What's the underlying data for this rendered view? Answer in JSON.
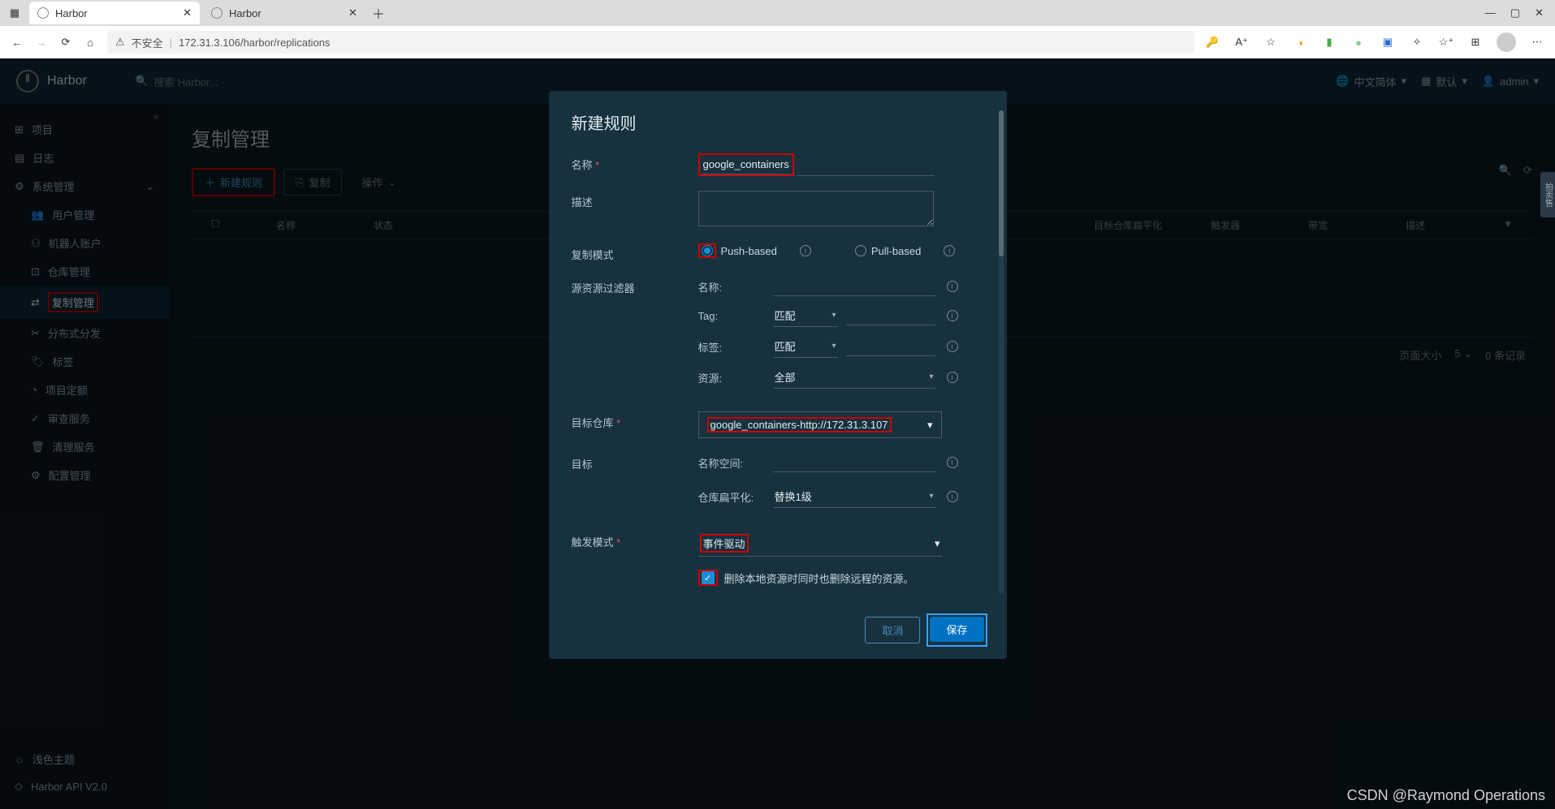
{
  "browser": {
    "tab1": "Harbor",
    "tab2": "Harbor",
    "url_prefix": "不安全",
    "url": "172.31.3.106/harbor/replications",
    "win_min": "—",
    "win_max": "▢",
    "win_close": "✕"
  },
  "header": {
    "brand": "Harbor",
    "search_ph": "搜索 Harbor...",
    "lang": "中文简体",
    "theme": "默认",
    "user": "admin"
  },
  "sidebar": {
    "collapse": "«",
    "items": {
      "projects": "项目",
      "logs": "日志",
      "sysmgmt": "系统管理",
      "usermgmt": "用户管理",
      "robots": "机器人账户",
      "registry": "仓库管理",
      "replication": "复制管理",
      "distribution": "分布式分发",
      "labels": "标签",
      "quotas": "项目定额",
      "interrogation": "审查服务",
      "gc": "清理服务",
      "config": "配置管理",
      "light_theme": "浅色主题",
      "api": "Harbor API V2.0"
    }
  },
  "main": {
    "title": "复制管理",
    "new_rule": "新建规则",
    "copy": "复制",
    "actions": "操作",
    "cols": {
      "name": "名称",
      "status": "状态",
      "dst_flat": "目标仓库扁平化",
      "trigger": "触发器",
      "bandwidth": "带宽",
      "desc": "描述"
    },
    "page_size_lbl": "页面大小",
    "page_size": "5",
    "records": "0 条记录"
  },
  "modal": {
    "title": "新建规则",
    "name_lbl": "名称",
    "name_val": "google_containers",
    "desc_lbl": "描述",
    "mode_lbl": "复制模式",
    "push": "Push-based",
    "pull": "Pull-based",
    "filter_lbl": "源资源过滤器",
    "flt_name": "名称:",
    "flt_tag": "Tag:",
    "flt_label": "标签:",
    "flt_res": "资源:",
    "match": "匹配",
    "all": "全部",
    "dst_repo_lbl": "目标仓库",
    "dst_repo_val": "google_containers-http://172.31.3.107",
    "dst_lbl": "目标",
    "ns_lbl": "名称空间:",
    "flat_lbl": "仓库扁平化:",
    "flat_val": "替换1级",
    "trigger_lbl": "触发模式",
    "trigger_val": "事件驱动",
    "del_remote": "删除本地资源时同时也删除远程的资源。",
    "cancel": "取消",
    "save": "保存"
  },
  "side_tab": "拍卖售",
  "watermark": "CSDN @Raymond Operations"
}
